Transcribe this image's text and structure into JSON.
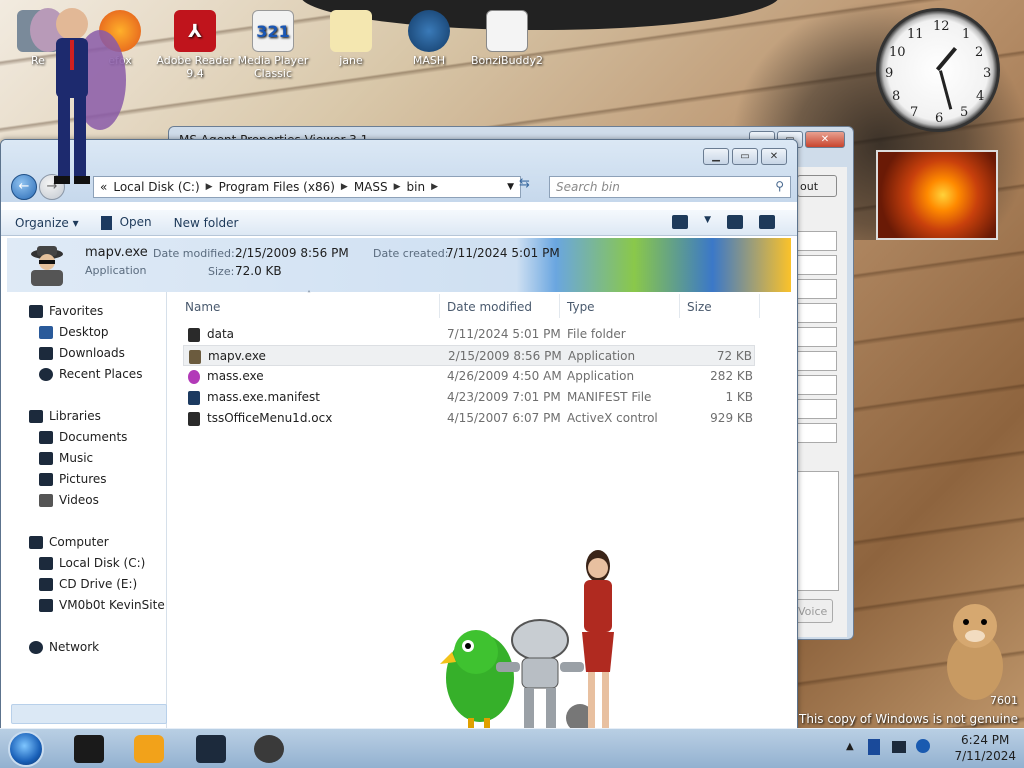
{
  "desktop_icons": [
    {
      "label": "Re"
    },
    {
      "label": "efox"
    },
    {
      "label": "Adobe Reader 9.4"
    },
    {
      "label": "Media Player Classic"
    },
    {
      "label": "jane"
    },
    {
      "label": "MASH"
    },
    {
      "label": "BonziBuddy2"
    }
  ],
  "bg_window": {
    "title": "MS Agent Properties Viewer 3.1",
    "about_label": "out",
    "voice_label": "Voice"
  },
  "explorer": {
    "path": [
      "Local Disk (C:)",
      "Program Files (x86)",
      "MASS",
      "bin"
    ],
    "path_prefix": "«",
    "search_placeholder": "Search bin",
    "toolbar": {
      "organize": "Organize",
      "open": "Open",
      "new_folder": "New folder"
    },
    "details": {
      "name": "mapv.exe",
      "type": "Application",
      "date_modified_label": "Date modified:",
      "date_modified": "2/15/2009 8:56 PM",
      "size_label": "Size:",
      "size": "72.0 KB",
      "date_created_label": "Date created:",
      "date_created": "7/11/2024 5:01 PM"
    },
    "nav": {
      "favorites": "Favorites",
      "desktop": "Desktop",
      "downloads": "Downloads",
      "recent": "Recent Places",
      "libraries": "Libraries",
      "documents": "Documents",
      "music": "Music",
      "pictures": "Pictures",
      "videos": "Videos",
      "computer": "Computer",
      "local_disk": "Local Disk (C:)",
      "cd_drive": "CD Drive (E:)",
      "vm": "VM0b0t KevinSite",
      "network": "Network"
    },
    "columns": {
      "name": "Name",
      "date": "Date modified",
      "type": "Type",
      "size": "Size"
    },
    "files": [
      {
        "name": "data",
        "date": "7/11/2024 5:01 PM",
        "type": "File folder",
        "size": ""
      },
      {
        "name": "mapv.exe",
        "date": "2/15/2009 8:56 PM",
        "type": "Application",
        "size": "72 KB"
      },
      {
        "name": "mass.exe",
        "date": "4/26/2009 4:50 AM",
        "type": "Application",
        "size": "282 KB"
      },
      {
        "name": "mass.exe.manifest",
        "date": "4/23/2009 7:01 PM",
        "type": "MANIFEST File",
        "size": "1 KB"
      },
      {
        "name": "tssOfficeMenu1d.ocx",
        "date": "4/15/2007 6:07 PM",
        "type": "ActiveX control",
        "size": "929 KB"
      }
    ]
  },
  "taskbar": {
    "time": "6:24 PM",
    "date": "7/11/2024"
  },
  "watermark": {
    "build": "7601",
    "genuine": "This copy of Windows is not genuine"
  }
}
